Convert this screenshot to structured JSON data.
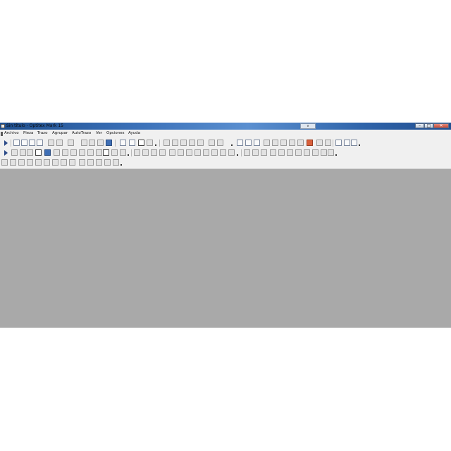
{
  "window": {
    "title": "Sin título - Optitex Mark 15",
    "mini_control": "∨",
    "buttons": {
      "minimize": "–",
      "maximize": "□",
      "close": "✕"
    }
  },
  "menu": {
    "items": [
      "Archivo",
      "Pieza",
      "Trazo",
      "Agrupar",
      "AutoTrazo",
      "Ver",
      "Opciones",
      "Ayuda"
    ]
  },
  "colors": {
    "workspace": "#a9a9a9",
    "titlebar": "#3a70b8",
    "toolbar_bg": "#f0f0f0",
    "accent_orange": "#d9603b"
  },
  "toolbar_icons": [
    "pointer-icon",
    "new-document-icon",
    "open-folder-icon",
    "save-icon",
    "print-icon",
    "undo-icon",
    "redo-icon",
    "zoom-icon",
    "info-icon",
    "rotate-icon",
    "flip-icon",
    "color-fill-icon",
    "grid-icon"
  ]
}
